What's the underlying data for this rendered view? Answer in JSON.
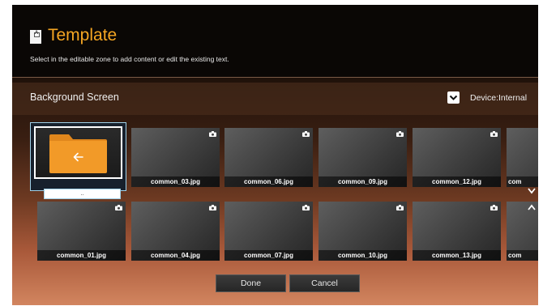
{
  "header": {
    "title": "Template",
    "subtitle": "Select in the editable zone to add content or edit the existing text.",
    "icon": "template-icon"
  },
  "background_bar": {
    "title": "Background Screen",
    "device_label": "Device:Internal",
    "device_checked": true
  },
  "folder": {
    "label": "..",
    "icon": "back-folder-icon"
  },
  "files": [
    "common_03.jpg",
    "common_06.jpg",
    "common_09.jpg",
    "common_12.jpg",
    "com",
    "common_01.jpg",
    "common_04.jpg",
    "common_07.jpg",
    "common_10.jpg",
    "common_13.jpg",
    "com"
  ],
  "buttons": {
    "done": "Done",
    "cancel": "Cancel"
  },
  "colors": {
    "accent": "#f5a623",
    "selection": "#9fd0e8",
    "tile": "#474747"
  }
}
